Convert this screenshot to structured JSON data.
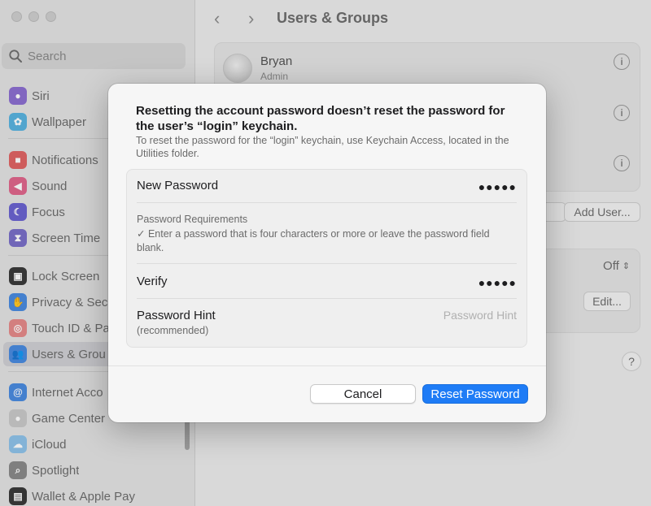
{
  "sidebar": {
    "search_placeholder": "Search",
    "items": [
      {
        "label": "Siri",
        "color": "#8d6fd1"
      },
      {
        "label": "Wallpaper",
        "color": "#5ab4e0"
      },
      {
        "label": "Notifications",
        "color": "#e06464"
      },
      {
        "label": "Sound",
        "color": "#e0668c"
      },
      {
        "label": "Focus",
        "color": "#6b63d1"
      },
      {
        "label": "Screen Time",
        "color": "#7a6fc8"
      },
      {
        "label": "Lock Screen",
        "color": "#3a3a3a"
      },
      {
        "label": "Privacy & Sec",
        "color": "#4a8be0"
      },
      {
        "label": "Touch ID & Pa",
        "color": "#e58a8a"
      },
      {
        "label": "Users & Grou",
        "color": "#4a8be0"
      },
      {
        "label": "Internet Acco",
        "color": "#4a8be0"
      },
      {
        "label": "Game Center",
        "color": "#c9c9c9"
      },
      {
        "label": "iCloud",
        "color": "#8fc3ea"
      },
      {
        "label": "Spotlight",
        "color": "#8a8a8a"
      },
      {
        "label": "Wallet & Apple Pay",
        "color": "#3a3a3a"
      }
    ]
  },
  "main": {
    "title": "Users & Groups",
    "users": [
      {
        "name": "Bryan",
        "role": "Admin"
      }
    ],
    "add_user_label": "Add User...",
    "off_label": "Off",
    "edit_label": "Edit...",
    "help_label": "?"
  },
  "dialog": {
    "title": "Resetting the account password doesn’t reset the password for the user’s “login” keychain.",
    "subtitle": "To reset the password for the “login” keychain, use Keychain Access, located in the Utilities folder.",
    "new_password_label": "New Password",
    "new_password_value": "●●●●●",
    "requirements_title": "Password Requirements",
    "requirements_text": "✓ Enter a password that is four characters or more or leave the password field blank.",
    "verify_label": "Verify",
    "verify_value": "●●●●●",
    "hint_label": "Password Hint",
    "hint_sublabel": "(recommended)",
    "hint_placeholder": "Password Hint",
    "cancel_label": "Cancel",
    "reset_label": "Reset Password"
  }
}
